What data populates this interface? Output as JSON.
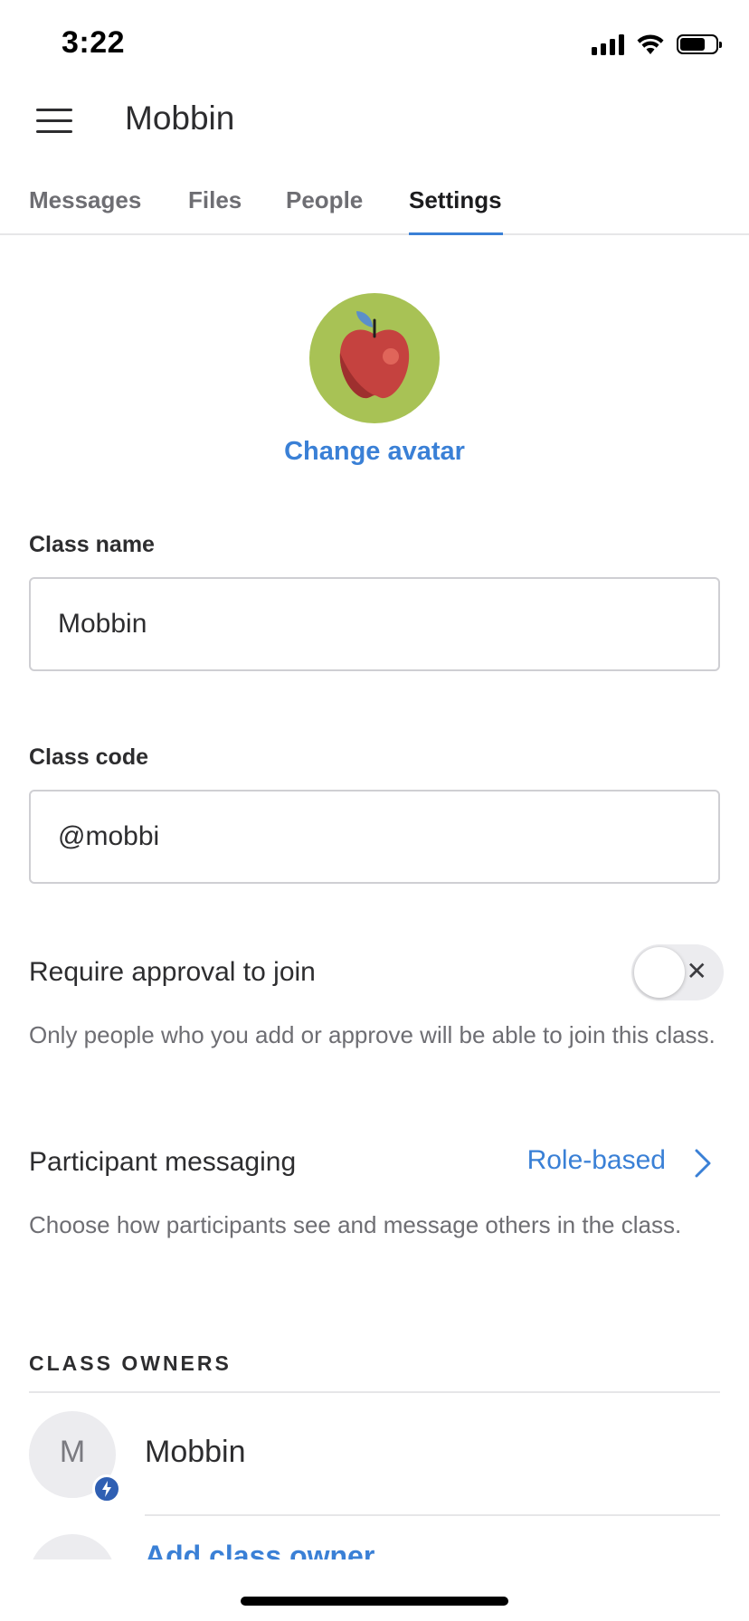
{
  "status_bar": {
    "time": "3:22",
    "icons": [
      "signal-icon",
      "wifi-icon",
      "battery-icon"
    ]
  },
  "header": {
    "title": "Mobbin",
    "menu_icon": "menu-icon"
  },
  "tabs": [
    {
      "label": "Messages",
      "active": false
    },
    {
      "label": "Files",
      "active": false
    },
    {
      "label": "People",
      "active": false
    },
    {
      "label": "Settings",
      "active": true
    }
  ],
  "avatar": {
    "icon": "apple-icon",
    "change_label": "Change avatar"
  },
  "class_name": {
    "label": "Class name",
    "value": "Mobbin"
  },
  "class_code": {
    "label": "Class code",
    "value": "@mobbi"
  },
  "require_approval": {
    "title": "Require approval to join",
    "enabled": false,
    "toggle_symbol": "✕",
    "description": "Only people who you add or approve will be able to join this class."
  },
  "participant_messaging": {
    "title": "Participant messaging",
    "value": "Role-based",
    "description": "Choose how participants see and message others in the class."
  },
  "class_owners": {
    "header": "CLASS OWNERS",
    "owners": [
      {
        "initial": "M",
        "name": "Mobbin"
      }
    ],
    "add_label": "Add class owner"
  },
  "colors": {
    "accent": "#3a80d6",
    "avatar_bg": "#a8c255",
    "badge": "#2f5fb3"
  }
}
